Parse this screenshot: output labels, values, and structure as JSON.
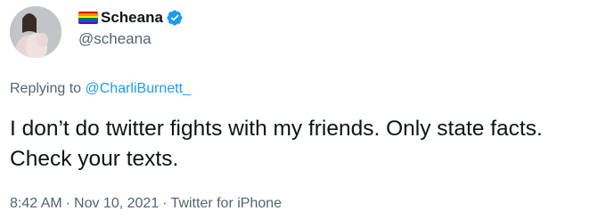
{
  "author": {
    "display_name": "Scheana",
    "handle": "@scheana",
    "flag_colors": [
      "#e40303",
      "#ff8c00",
      "#ffed00",
      "#008026",
      "#004dff",
      "#750787"
    ],
    "verified_color": "#1d9bf0"
  },
  "reply": {
    "prefix": "Replying to ",
    "target": "@CharliBurnett_"
  },
  "tweet": {
    "text": "I don’t do twitter fights with my friends. Only state facts. Check your texts."
  },
  "meta": {
    "time": "8:42 AM",
    "separator": "·",
    "date": "Nov 10, 2021",
    "source": "Twitter for iPhone"
  },
  "icons": {
    "avatar": "profile-photo",
    "verified": "verified-badge-icon",
    "flag": "rainbow-flag-icon"
  }
}
